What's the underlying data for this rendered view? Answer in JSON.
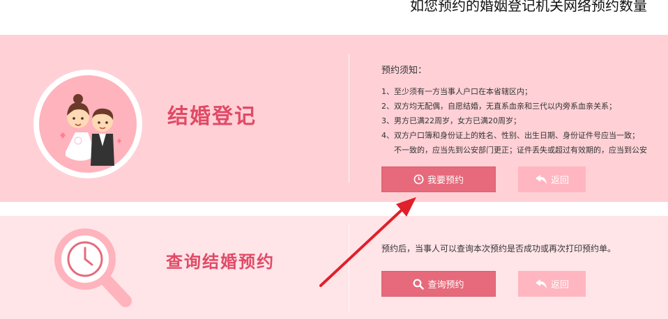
{
  "header": {
    "title": "如您预约的婚姻登记机关网络预约数量"
  },
  "marriage": {
    "heading": "结婚登记",
    "notes_title": "预约须知：",
    "notes": [
      "1、至少须有一方当事人户口在本省辖区内；",
      "2、双方均无配偶，自愿结婚，无直系血亲和三代以内旁系血亲关系；",
      "3、男方已满22周岁，女方已满20周岁；",
      "4、双方户口簿和身份证上的姓名、性别、出生日期、身份证件号应当一致；",
      "不一致的，应当先到公安部门更正；证件丢失或超过有效期的，应当到公安"
    ],
    "primary_button": "我要预约",
    "back_button": "返回"
  },
  "query": {
    "heading": "查询结婚预约",
    "text": "预约后，当事人可以查询本次预约是否成功或再次打印预约单。",
    "primary_button": "查询预约",
    "back_button": "返回"
  },
  "colors": {
    "marriage_panel": "#ffd1d6",
    "query_panel": "#ffe4e8",
    "primary_button": "#e66a7b",
    "secondary_button": "#ffb6c0",
    "heading": "#e04a66",
    "annotation_arrow": "#e0202a"
  },
  "icons": {
    "marriage_avatar": "wedding-couple-icon",
    "query_avatar": "clock-magnifier-icon",
    "book_button": "clock-icon",
    "query_button": "search-icon",
    "back_button": "return-arrow-icon"
  }
}
